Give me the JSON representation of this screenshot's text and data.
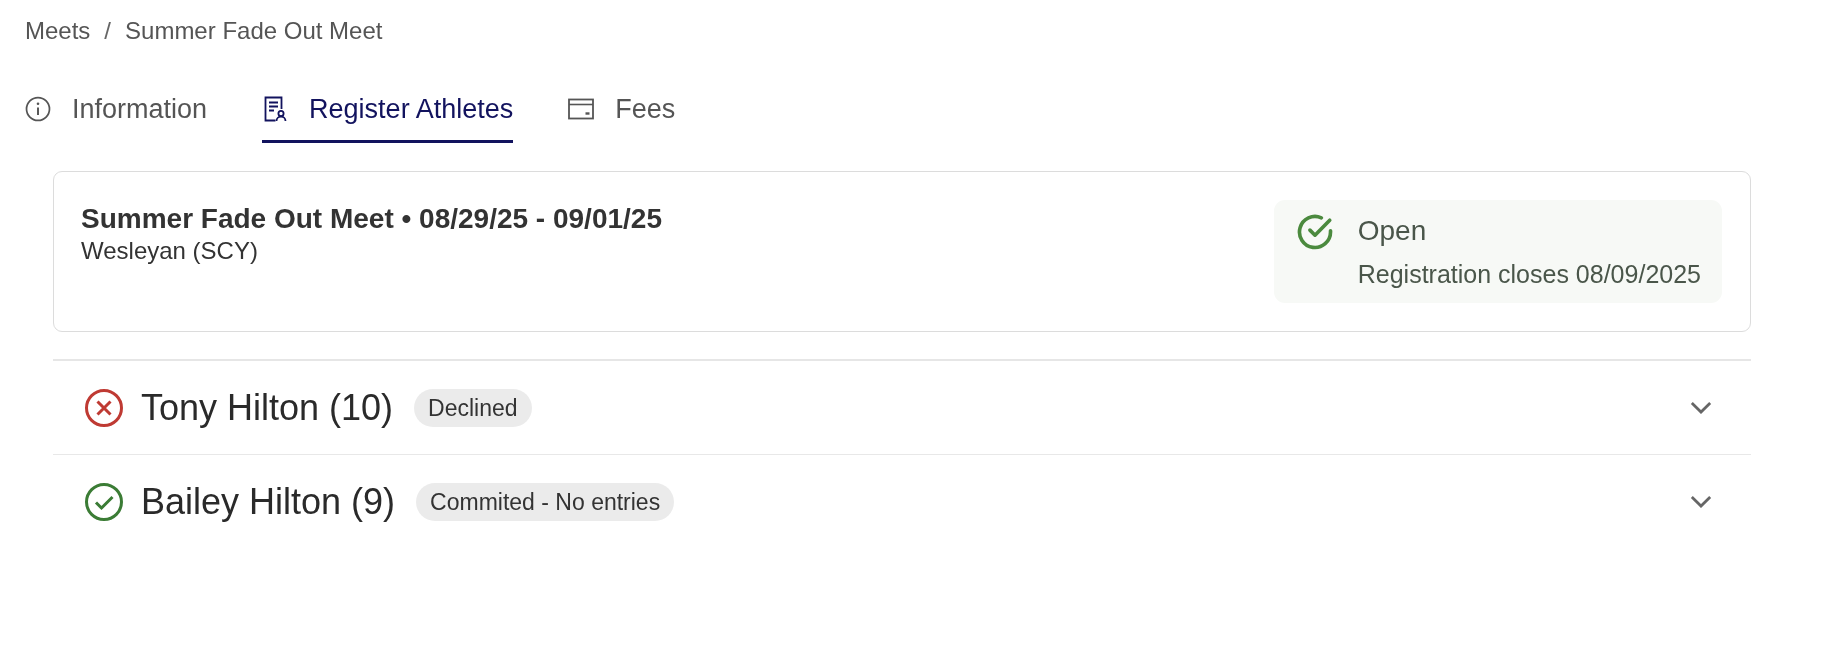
{
  "breadcrumb": {
    "separator": "/",
    "items": [
      {
        "label": "Meets"
      },
      {
        "label": "Summer Fade Out Meet"
      }
    ]
  },
  "tabs": [
    {
      "label": "Information",
      "selected": false
    },
    {
      "label": "Register Athletes",
      "selected": true
    },
    {
      "label": "Fees",
      "selected": false
    }
  ],
  "meet": {
    "title": "Summer Fade Out Meet • 08/29/25 - 09/01/25",
    "venue": "Wesleyan (SCY)",
    "status": {
      "kind": "open",
      "label": "Open",
      "note": "Registration closes 08/09/2025"
    }
  },
  "athletes": [
    {
      "name": "Tony Hilton (10)",
      "kind": "declined",
      "badge": "Declined",
      "expanded": false
    },
    {
      "name": "Bailey Hilton (9)",
      "kind": "committed",
      "badge": "Commited - No entries",
      "expanded": false
    }
  ]
}
